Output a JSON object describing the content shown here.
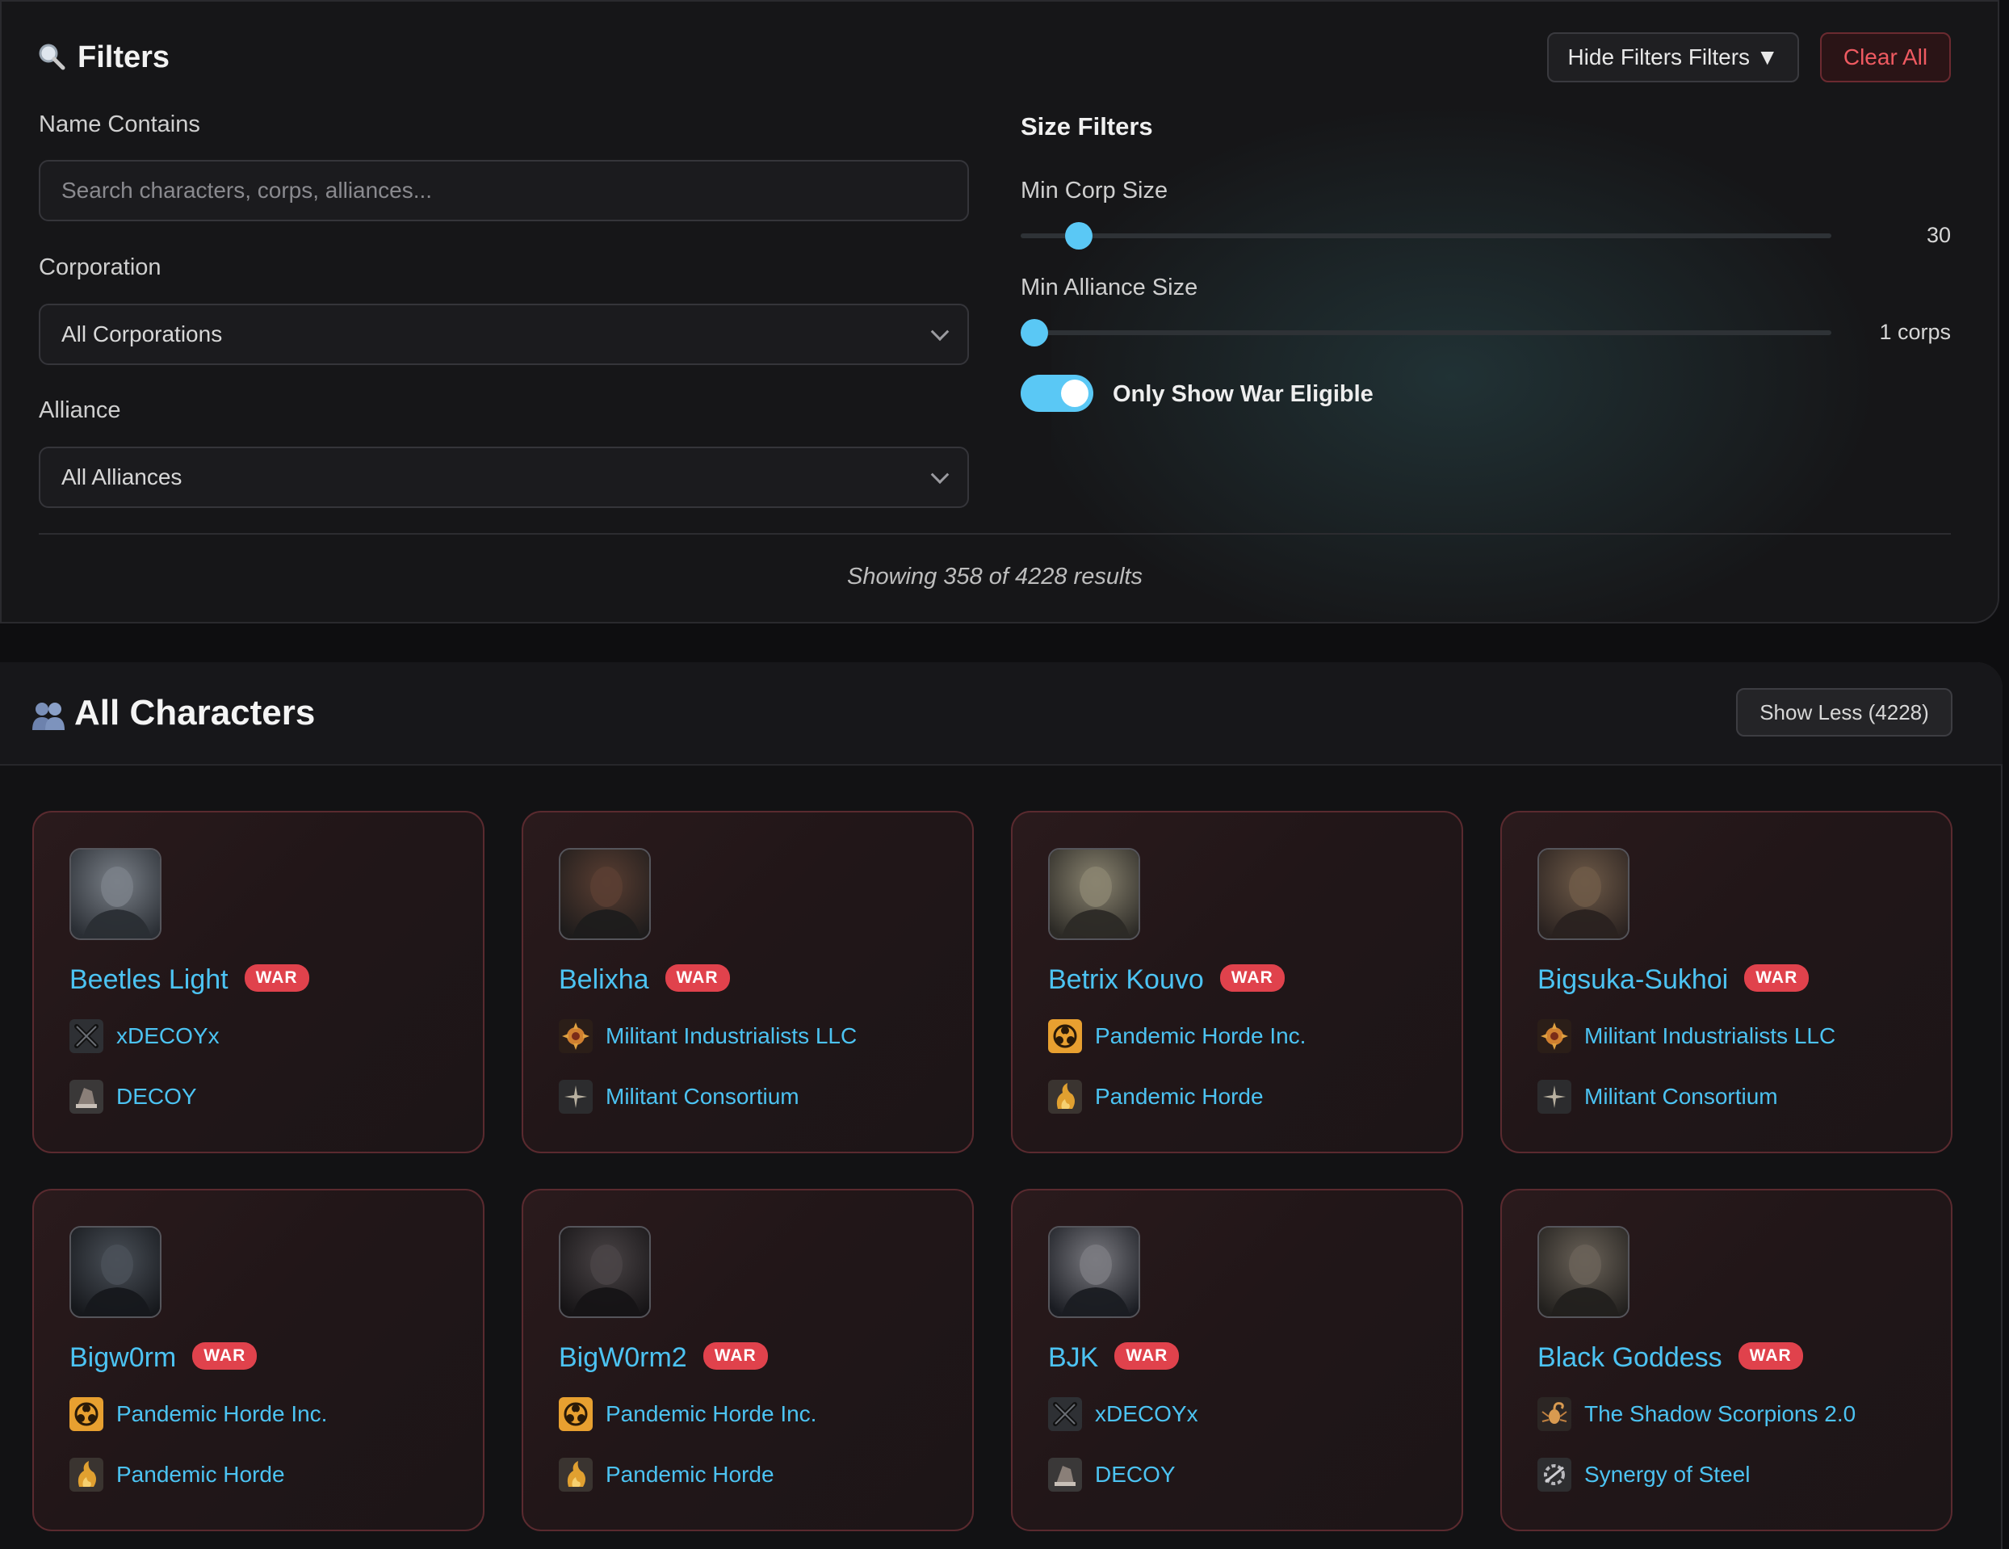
{
  "filters": {
    "title": "Filters",
    "hide_filters_label": "Hide Filters Filters ▼",
    "clear_all_label": "Clear All",
    "name_contains": {
      "label": "Name Contains",
      "placeholder": "Search characters, corps, alliances...",
      "value": ""
    },
    "corporation": {
      "label": "Corporation",
      "selected": "All Corporations"
    },
    "alliance": {
      "label": "Alliance",
      "selected": "All Alliances"
    },
    "size_filters": {
      "title": "Size Filters",
      "min_corp": {
        "label": "Min Corp Size",
        "value_text": "30",
        "fraction": 0.04
      },
      "min_alliance": {
        "label": "Min Alliance Size",
        "value_text": "1 corps",
        "fraction": 0.0
      },
      "war_toggle": {
        "label": "Only Show War Eligible",
        "on": true
      }
    },
    "results_text": "Showing 358 of 4228 results"
  },
  "characters": {
    "title": "All Characters",
    "show_less_label": "Show Less (4228)",
    "war_label": "WAR",
    "cards": [
      {
        "name": "Beetles Light",
        "corp": "xDECOYx",
        "corp_icon": "crossed-swords-icon",
        "alliance": "DECOY",
        "alliance_icon": "decoy-logo-icon",
        "portrait_colors": [
          "#7a8088",
          "#2a2e34"
        ]
      },
      {
        "name": "Belixha",
        "corp": "Militant Industrialists LLC",
        "corp_icon": "militant-gear-icon",
        "alliance": "Militant Consortium",
        "alliance_icon": "star-burst-icon",
        "portrait_colors": [
          "#5a3e32",
          "#1e1c1c"
        ]
      },
      {
        "name": "Betrix Kouvo",
        "corp": "Pandemic Horde Inc.",
        "corp_icon": "biohazard-icon",
        "alliance": "Pandemic Horde",
        "alliance_icon": "horde-flame-icon",
        "portrait_colors": [
          "#8a8470",
          "#2c2a26"
        ]
      },
      {
        "name": "Bigsuka-Sukhoi",
        "corp": "Militant Industrialists LLC",
        "corp_icon": "militant-gear-icon",
        "alliance": "Militant Consortium",
        "alliance_icon": "star-burst-icon",
        "portrait_colors": [
          "#6e5a48",
          "#2a2220"
        ]
      },
      {
        "name": "Bigw0rm",
        "corp": "Pandemic Horde Inc.",
        "corp_icon": "biohazard-icon",
        "alliance": "Pandemic Horde",
        "alliance_icon": "horde-flame-icon",
        "portrait_colors": [
          "#4a5058",
          "#16181c"
        ]
      },
      {
        "name": "BigW0rm2",
        "corp": "Pandemic Horde Inc.",
        "corp_icon": "biohazard-icon",
        "alliance": "Pandemic Horde",
        "alliance_icon": "horde-flame-icon",
        "portrait_colors": [
          "#4a4446",
          "#161416"
        ]
      },
      {
        "name": "BJK",
        "corp": "xDECOYx",
        "corp_icon": "crossed-swords-icon",
        "alliance": "DECOY",
        "alliance_icon": "decoy-logo-icon",
        "portrait_colors": [
          "#7a7a80",
          "#1a1c22"
        ]
      },
      {
        "name": "Black Goddess",
        "corp": "The Shadow Scorpions 2.0",
        "corp_icon": "scorpion-icon",
        "alliance": "Synergy of Steel",
        "alliance_icon": "steel-gear-icon",
        "portrait_colors": [
          "#6a6258",
          "#22201e"
        ]
      }
    ]
  },
  "icons": {
    "filters": "magnifier-icon",
    "characters": "people-icon"
  },
  "colors": {
    "accent": "#4cc3f2",
    "war_badge": "#e0424c",
    "clear_all": "#ef5a61",
    "slider": "#5ac8f5"
  }
}
